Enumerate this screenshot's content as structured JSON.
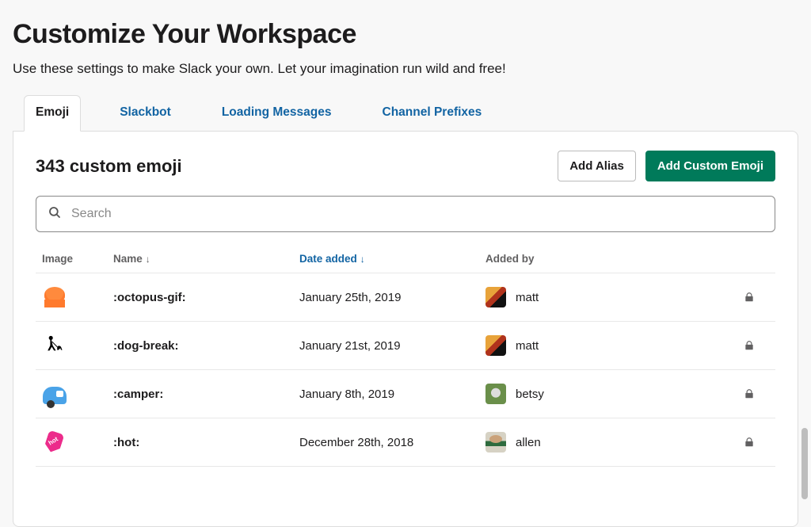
{
  "header": {
    "title": "Customize Your Workspace",
    "subtitle": "Use these settings to make Slack your own. Let your imagination run wild and free!"
  },
  "tabs": [
    {
      "id": "emoji",
      "label": "Emoji",
      "active": true
    },
    {
      "id": "slackbot",
      "label": "Slackbot",
      "active": false
    },
    {
      "id": "loading",
      "label": "Loading Messages",
      "active": false
    },
    {
      "id": "prefixes",
      "label": "Channel Prefixes",
      "active": false
    }
  ],
  "panel": {
    "count_label": "343 custom emoji",
    "actions": {
      "add_alias": "Add Alias",
      "add_emoji": "Add Custom Emoji"
    },
    "search": {
      "placeholder": "Search",
      "value": ""
    },
    "columns": {
      "image": "Image",
      "name": "Name",
      "date": "Date added",
      "added_by": "Added by"
    },
    "sort": {
      "column": "date",
      "direction": "desc",
      "secondary": "name"
    },
    "rows": [
      {
        "emoji_id": "octopus",
        "name": ":octopus-gif:",
        "date": "January 25th, 2019",
        "user": "matt",
        "avatar": "av-matt",
        "locked": true
      },
      {
        "emoji_id": "dogwalk",
        "name": ":dog-break:",
        "date": "January 21st, 2019",
        "user": "matt",
        "avatar": "av-matt",
        "locked": true
      },
      {
        "emoji_id": "camper",
        "name": ":camper:",
        "date": "January 8th, 2019",
        "user": "betsy",
        "avatar": "av-betsy",
        "locked": true
      },
      {
        "emoji_id": "hot",
        "name": ":hot:",
        "date": "December 28th, 2018",
        "user": "allen",
        "avatar": "av-allen",
        "locked": true
      }
    ]
  },
  "colors": {
    "link": "#1264a3",
    "primary": "#007a5a"
  }
}
